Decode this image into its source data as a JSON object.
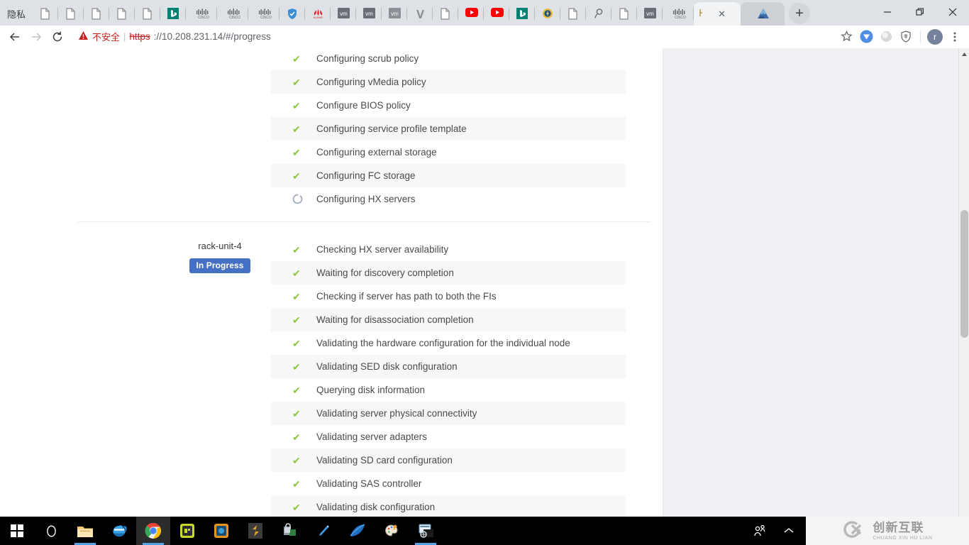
{
  "browser": {
    "privacy_label": "隐私",
    "tabs": [
      {
        "icon": "document-icon",
        "title": ""
      },
      {
        "icon": "document-icon",
        "title": ""
      },
      {
        "icon": "document-icon",
        "title": ""
      },
      {
        "icon": "document-icon",
        "title": ""
      },
      {
        "icon": "document-icon",
        "title": ""
      },
      {
        "icon": "bing-icon",
        "title": ""
      },
      {
        "icon": "cisco-icon",
        "title": ""
      },
      {
        "icon": "cisco-icon",
        "title": ""
      },
      {
        "icon": "cisco-icon",
        "title": ""
      },
      {
        "icon": "shield-check-icon",
        "title": ""
      },
      {
        "icon": "huawei-icon",
        "title": ""
      },
      {
        "icon": "vmware-icon",
        "title": ""
      },
      {
        "icon": "vmware-icon",
        "title": ""
      },
      {
        "icon": "vmware-icon",
        "title": ""
      },
      {
        "icon": "v-logo-icon",
        "title": ""
      },
      {
        "icon": "document-icon",
        "title": ""
      },
      {
        "icon": "youtube-icon",
        "title": ""
      },
      {
        "icon": "youtube-icon",
        "title": ""
      },
      {
        "icon": "bing-icon",
        "title": ""
      },
      {
        "icon": "shield-gold-icon",
        "title": ""
      },
      {
        "icon": "document-icon",
        "title": ""
      },
      {
        "icon": "search-glass-icon",
        "title": ""
      },
      {
        "icon": "document-icon",
        "title": ""
      },
      {
        "icon": "vmware-icon",
        "title": ""
      },
      {
        "icon": "cisco-icon",
        "title": ""
      }
    ],
    "active_tab": {
      "label": "",
      "close_label": "✕",
      "icon": "hx-icon"
    },
    "next_tab": {
      "icon": "mountain-triangle-icon"
    },
    "new_tab_label": "+",
    "window_controls": {
      "minimize": "minimize-icon",
      "restore": "restore-icon",
      "close": "close-icon"
    },
    "toolbar": {
      "back": "back-arrow-icon",
      "forward": "forward-arrow-icon",
      "reload": "reload-icon",
      "security_warning_label": "不安全",
      "url_scheme": "https",
      "url_rest": "://10.208.231.14/#/progress",
      "full_url": "https://10.208.231.14/#/progress",
      "bookmark": "star-icon",
      "extension_one": "extension-blue-icon",
      "extension_two": "extension-gray-icon",
      "extension_three": "shield-extension-icon",
      "profile_initial": "r",
      "menu": "three-dot-menu-icon"
    }
  },
  "colors": {
    "badge_in_progress": "#4571c4",
    "check_green": "#8cc63f",
    "spinner_gray": "#9aa5b5",
    "not_secure_red": "#c5221f",
    "page_bg": "#f0f0f5",
    "row_alt": "#f7f7f7",
    "taskbar_accent": "#4ea3e0"
  },
  "page": {
    "groups": [
      {
        "node_name": "",
        "status": "",
        "tasks": [
          {
            "state": "done",
            "label": "Configuring scrub policy"
          },
          {
            "state": "done",
            "label": "Configuring vMedia policy"
          },
          {
            "state": "done",
            "label": "Configure BIOS policy"
          },
          {
            "state": "done",
            "label": "Configuring service profile template"
          },
          {
            "state": "done",
            "label": "Configuring external storage"
          },
          {
            "state": "done",
            "label": "Configuring FC storage"
          },
          {
            "state": "running",
            "label": "Configuring HX servers"
          }
        ]
      },
      {
        "node_name": "rack-unit-4",
        "status": "In Progress",
        "tasks": [
          {
            "state": "done",
            "label": "Checking HX server availability"
          },
          {
            "state": "done",
            "label": "Waiting for discovery completion"
          },
          {
            "state": "done",
            "label": "Checking if server has path to both the FIs"
          },
          {
            "state": "done",
            "label": "Waiting for disassociation completion"
          },
          {
            "state": "done",
            "label": "Validating the hardware configuration for the individual node"
          },
          {
            "state": "done",
            "label": "Validating SED disk configuration"
          },
          {
            "state": "done",
            "label": "Querying disk information"
          },
          {
            "state": "done",
            "label": "Validating server physical connectivity"
          },
          {
            "state": "done",
            "label": "Validating server adapters"
          },
          {
            "state": "done",
            "label": "Validating SD card configuration"
          },
          {
            "state": "done",
            "label": "Validating SAS controller"
          },
          {
            "state": "done",
            "label": "Validating disk configuration"
          }
        ]
      }
    ],
    "icons": {
      "done": "check-icon",
      "running": "spinner-icon"
    }
  },
  "taskbar": {
    "items": [
      {
        "name": "start-button",
        "icon": "windows-logo-icon"
      },
      {
        "name": "cortana-search",
        "icon": "circle-search-icon"
      },
      {
        "name": "file-explorer",
        "icon": "folder-icon"
      },
      {
        "name": "internet-explorer",
        "icon": "ie-icon"
      },
      {
        "name": "google-chrome",
        "icon": "chrome-icon"
      },
      {
        "name": "putty",
        "icon": "putty-icon"
      },
      {
        "name": "teams",
        "icon": "teams-icon"
      },
      {
        "name": "sublime-text",
        "icon": "sublime-icon"
      },
      {
        "name": "secure-crt",
        "icon": "securecrt-icon"
      },
      {
        "name": "notepad-plus",
        "icon": "pen-icon"
      },
      {
        "name": "wireshark",
        "icon": "wireshark-icon"
      },
      {
        "name": "paint",
        "icon": "paint-icon"
      },
      {
        "name": "winscp",
        "icon": "winscp-icon"
      }
    ],
    "tray": [
      {
        "name": "people-icon",
        "glyph": "people"
      },
      {
        "name": "show-hidden-icons-chevron",
        "glyph": "chevron-up"
      }
    ],
    "watermark": {
      "cn": "创新互联",
      "en": "CHUANG XIN HU LIAN"
    }
  }
}
